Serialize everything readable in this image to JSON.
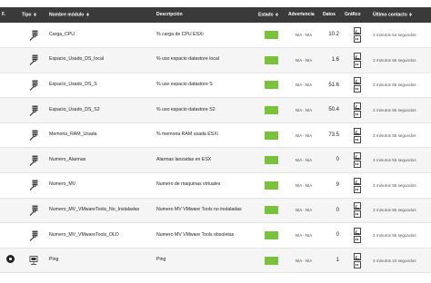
{
  "top_strip_text": "",
  "header": {
    "f": "F.",
    "tipo": "Tipo",
    "nombre": "Nombre módulo",
    "descripcion": "Descripción",
    "estado": "Estado",
    "advertencia": "Advertencia",
    "datos": "Datos",
    "grafico": "Gráfico",
    "ultimo_contacto": "Último contacto"
  },
  "colors": {
    "header_bg": "#3a3a3a",
    "status_ok": "#79c33a",
    "row_alt": "#f5f5f5"
  },
  "rows": [
    {
      "f": "",
      "tipo_icon": "server-wrench-icon",
      "name": "Carga_CPU",
      "desc": "% carga de CPU ESXi",
      "adv": "N/A - N/A",
      "datos": "10.2",
      "last": "3 minutos 54 segundos"
    },
    {
      "f": "",
      "tipo_icon": "server-wrench-icon",
      "name": "Espacio_Usado_DS_local",
      "desc": "% uso espacio datastore local",
      "adv": "N/A - N/A",
      "datos": "1.6",
      "last": "3 minutos 55 segundos"
    },
    {
      "f": "",
      "tipo_icon": "server-wrench-icon",
      "name": "Espacio_Usado_DS_S",
      "desc": "% uso espacio datastore S",
      "adv": "N/A - N/A",
      "datos": "51.6",
      "last": "3 minutos 55 segundos"
    },
    {
      "f": "",
      "tipo_icon": "server-wrench-icon",
      "name": "Espacio_Usado_DS_S2",
      "desc": "% uso espacio datastore S2",
      "adv": "N/A - N/A",
      "datos": "50.4",
      "last": "3 minutos 55 segundos"
    },
    {
      "f": "",
      "tipo_icon": "server-wrench-icon",
      "name": "Memoria_RAM_Usada",
      "desc": "% memoria RAM usada ESXi",
      "adv": "N/A - N/A",
      "datos": "73.5",
      "last": "3 minutos 55 segundos"
    },
    {
      "f": "",
      "tipo_icon": "server-wrench-icon",
      "name": "Numero_Alarmas",
      "desc": "Alarmas lanzadas en ESX",
      "adv": "N/A - N/A",
      "datos": "0",
      "last": "3 minutos 55 segundos"
    },
    {
      "f": "",
      "tipo_icon": "server-wrench-icon",
      "name": "Numero_MV",
      "desc": "Numero de maquinas virtuales",
      "adv": "N/A - N/A",
      "datos": "9",
      "last": "3 minutos 55 segundos"
    },
    {
      "f": "",
      "tipo_icon": "server-wrench-icon",
      "name": "Numero_MV_VMwareTools_No_Instaladas",
      "desc": "Numero MV VMware Tools no instaladas",
      "adv": "N/A - N/A",
      "datos": "0",
      "last": "3 minutos 55 segundos"
    },
    {
      "f": "",
      "tipo_icon": "server-wrench-icon",
      "name": "Numero_MV_VMwareTools_OLD",
      "desc": "Numero MV VMware Tools obsoletas",
      "adv": "N/A - N/A",
      "datos": "0",
      "last": "3 minutos 55 segundos"
    },
    {
      "f": "radio",
      "tipo_icon": "network-ping-icon",
      "name": "Ping",
      "desc": "Ping",
      "adv": "N/A - N/A",
      "datos": "1",
      "last": "3 minutos 10 segundos"
    }
  ]
}
